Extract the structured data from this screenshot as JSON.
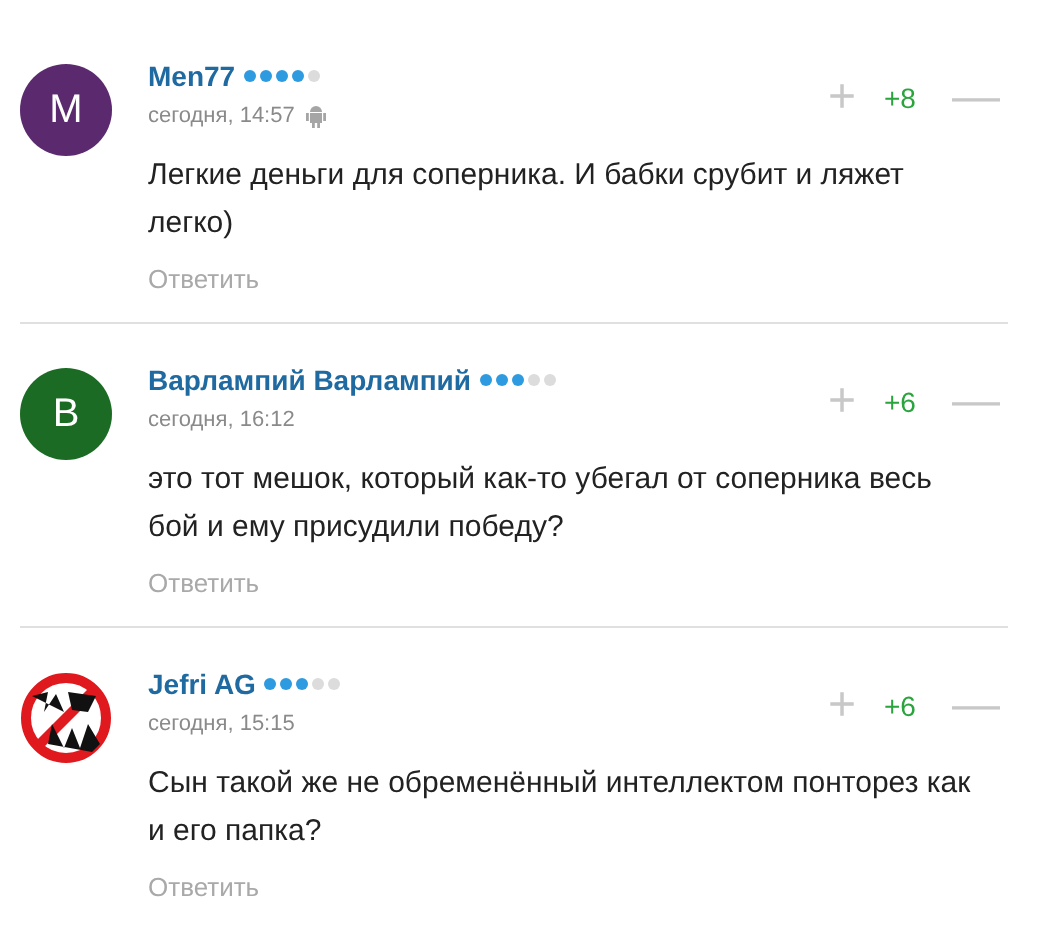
{
  "comments": [
    {
      "avatar": {
        "kind": "letter",
        "letter": "M",
        "color": "#5b2a6e"
      },
      "author": "Men77",
      "stars": 4,
      "time": "сегодня, 14:57",
      "android": true,
      "plus": "+",
      "score": "+8",
      "minus": "—",
      "text": "Легкие деньги для соперника. И бабки срубит и ляжет легко)",
      "reply": "Ответить"
    },
    {
      "avatar": {
        "kind": "letter",
        "letter": "В",
        "color": "#1b6b24"
      },
      "author": "Варлампий Варлампий",
      "stars": 3,
      "time": "сегодня, 16:12",
      "android": false,
      "plus": "+",
      "score": "+6",
      "minus": "—",
      "text": "это тот мешок, который как-то убегал от соперника весь бой и ему присудили победу?",
      "reply": "Ответить"
    },
    {
      "author": "Jefri AG",
      "stars": 3,
      "time": "сегодня, 15:15",
      "android": false,
      "plus": "+",
      "score": "+6",
      "minus": "—",
      "text": "Сын такой же не обременённый интеллектом понторез как и его папка?",
      "reply": "Ответить"
    }
  ]
}
